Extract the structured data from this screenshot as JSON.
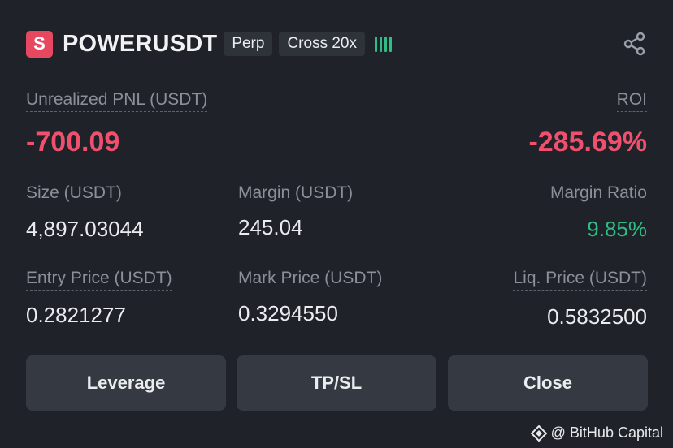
{
  "position": {
    "side_badge": "S",
    "symbol": "POWERUSDT",
    "tags": [
      "Perp",
      "Cross 20x"
    ],
    "strength_color": "#2ebd85"
  },
  "pnl": {
    "label": "Unrealized PNL (USDT)",
    "value": "-700.09",
    "roi_label": "ROI",
    "roi_value": "-285.69%",
    "negative_color": "#f0506e"
  },
  "stats": {
    "size_label": "Size (USDT)",
    "size_value": "4,897.03044",
    "margin_label": "Margin (USDT)",
    "margin_value": "245.04",
    "margin_ratio_label": "Margin Ratio",
    "margin_ratio_value": "9.85%",
    "entry_label": "Entry Price (USDT)",
    "entry_value": "0.2821277",
    "mark_label": "Mark Price (USDT)",
    "mark_value": "0.3294550",
    "liq_label": "Liq. Price (USDT)",
    "liq_value": "0.5832500"
  },
  "actions": {
    "leverage": "Leverage",
    "tpsl": "TP/SL",
    "close": "Close"
  },
  "icons": {
    "share": "share-icon",
    "watermark": "bithub-logo-icon"
  },
  "watermark": {
    "text": "@ BitHub Capital"
  }
}
